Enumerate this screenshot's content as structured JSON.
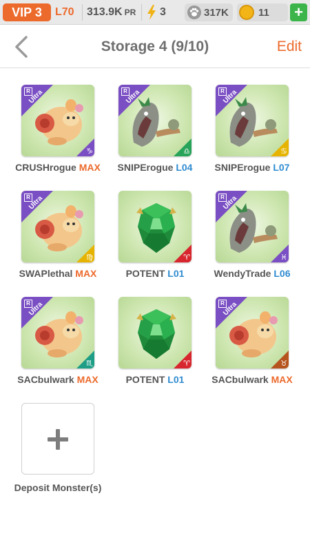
{
  "status_bar": {
    "vip_label": "VIP 3",
    "level": "L70",
    "power_value": "313.9K",
    "power_unit": "PR",
    "energy": "3",
    "paw_count": "317K",
    "coin_count": "11",
    "add_label": "+",
    "colors": {
      "vip_bg": "#ec6a2c",
      "level": "#ec6a2c",
      "add_bg": "#3bb54a",
      "coin": "#f2b416"
    },
    "icons": {
      "energy": "lightning-bolt-icon",
      "paw": "paw-icon",
      "coin": "coin-icon"
    }
  },
  "nav": {
    "title": "Storage 4 (9/10)",
    "edit_label": "Edit",
    "back_icon": "chevron-left-icon"
  },
  "monsters": [
    {
      "name": "CRUSHrogue",
      "level": "MAX",
      "level_type": "max",
      "rarity": "Ultra",
      "rank": "R",
      "zodiac": "♑",
      "zodiac_color": "#7b4fc4",
      "art": "cat"
    },
    {
      "name": "SNIPErogue",
      "level": "L04",
      "level_type": "num",
      "rarity": "Ultra",
      "rank": "R",
      "zodiac": "♎",
      "zodiac_color": "#27a35a",
      "art": "plant"
    },
    {
      "name": "SNIPErogue",
      "level": "L07",
      "level_type": "num",
      "rarity": "Ultra",
      "rank": "R",
      "zodiac": "♋",
      "zodiac_color": "#e6b400",
      "art": "plant"
    },
    {
      "name": "SWAPlethal",
      "level": "MAX",
      "level_type": "max",
      "rarity": "Ultra",
      "rank": "R",
      "zodiac": "♍",
      "zodiac_color": "#e6b400",
      "art": "cat"
    },
    {
      "name": "POTENT",
      "level": "L01",
      "level_type": "num",
      "rarity": "",
      "rank": "",
      "zodiac": "♈",
      "zodiac_color": "#d8262e",
      "art": "gem"
    },
    {
      "name": "WendyTrade",
      "level": "L06",
      "level_type": "num",
      "rarity": "Ultra",
      "rank": "R",
      "zodiac": "♓",
      "zodiac_color": "#7b4fc4",
      "art": "plant"
    },
    {
      "name": "SACbulwark",
      "level": "MAX",
      "level_type": "max",
      "rarity": "Ultra",
      "rank": "R",
      "zodiac": "♏",
      "zodiac_color": "#1e9e86",
      "art": "cat"
    },
    {
      "name": "POTENT",
      "level": "L01",
      "level_type": "num",
      "rarity": "",
      "rank": "",
      "zodiac": "♈",
      "zodiac_color": "#d8262e",
      "art": "gem"
    },
    {
      "name": "SACbulwark",
      "level": "MAX",
      "level_type": "max",
      "rarity": "Ultra",
      "rank": "R",
      "zodiac": "♉",
      "zodiac_color": "#b5541e",
      "art": "cat"
    }
  ],
  "deposit": {
    "label": "Deposit Monster(s)",
    "icon": "plus-icon"
  }
}
